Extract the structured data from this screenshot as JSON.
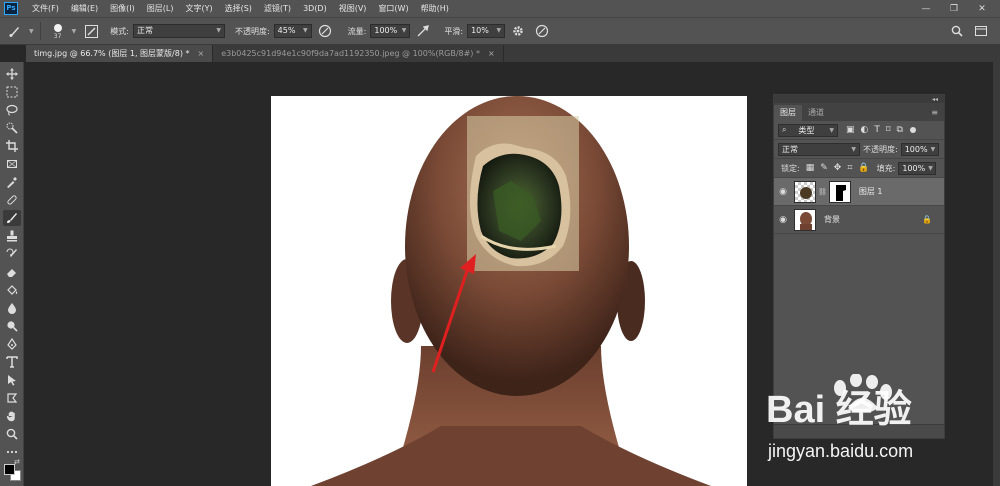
{
  "app": {
    "logo": "Ps"
  },
  "menu": {
    "items": [
      "文件(F)",
      "编辑(E)",
      "图像(I)",
      "图层(L)",
      "文字(Y)",
      "选择(S)",
      "滤镜(T)",
      "3D(D)",
      "视图(V)",
      "窗口(W)",
      "帮助(H)"
    ]
  },
  "window_controls": {
    "minimize": "—",
    "restore": "❐",
    "close": "✕"
  },
  "options": {
    "brush_size": "37",
    "mode_label": "模式:",
    "mode_value": "正常",
    "opacity_label": "不透明度:",
    "opacity_value": "45%",
    "flow_label": "流量:",
    "flow_value": "100%",
    "smooth_label": "平滑:",
    "smooth_value": "10%"
  },
  "tabs": [
    {
      "label": "timg.jpg @ 66.7% (图层 1, 图层蒙版/8) *",
      "close": "×"
    },
    {
      "label": "e3b0425c91d94e1c90f9da7ad1192350.jpeg @ 100%(RGB/8#) *",
      "close": "×"
    }
  ],
  "layers_panel": {
    "tabs": [
      "图层",
      "通道"
    ],
    "filter_value": "类型",
    "blend_mode": "正常",
    "opacity_label": "不透明度:",
    "opacity_value": "100%",
    "lock_label": "锁定:",
    "fill_label": "填充:",
    "fill_value": "100%",
    "layers": [
      {
        "name": "图层 1",
        "selected": true
      },
      {
        "name": "背景",
        "selected": false
      }
    ]
  },
  "watermark": {
    "brand": "Bai 经验",
    "url": "jingyan.baidu.com"
  },
  "colors": {
    "accent": "#31a8ff",
    "panel": "#535353",
    "canvas_bg": "#282828",
    "arrow": "#e02020"
  },
  "icons": [
    "brush-icon",
    "move-icon",
    "marquee-icon",
    "lasso-icon",
    "quick-select-icon",
    "crop-icon",
    "frame-icon",
    "eyedropper-icon",
    "healing-icon",
    "stamp-icon",
    "history-brush-icon",
    "eraser-icon",
    "paint-bucket-icon",
    "blur-icon",
    "dodge-icon",
    "pen-icon",
    "type-icon",
    "path-select-icon",
    "shape-icon",
    "hand-icon",
    "zoom-icon",
    "eye-icon",
    "lock-icon",
    "search-icon",
    "workspace-icon",
    "share-icon"
  ]
}
